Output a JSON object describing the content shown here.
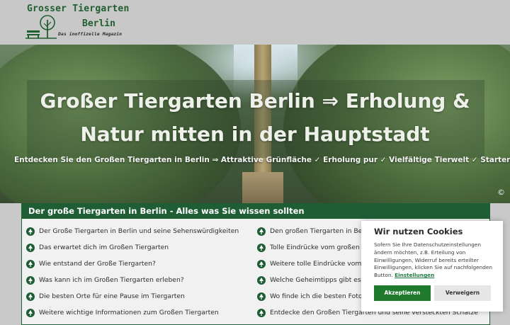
{
  "logo": {
    "line1": "Grosser Tiergarten",
    "line2": "Berlin",
    "tagline": "Das inoffizelle Magazin"
  },
  "hero": {
    "title": "Großer Tiergarten Berlin ⇒ Erholung & Natur mitten in der Hauptstadt",
    "subtitle": "Entdecken Sie den Großen Tiergarten in Berlin ⇒ Attraktive Grünfläche ✓ Erholung pur ✓ Vielfältige Tierwelt ✓ Starten Sie Ihr Abenteuer jetzt!",
    "copyright": "©"
  },
  "toc": {
    "heading": "Der große Tiergarten in Berlin - Alles was Sie wissen sollten",
    "left": [
      "Der Große Tiergarten in Berlin und seine Sehenswürdigkeiten",
      "Das erwartet dich im Großen Tiergarten",
      "Wie entstand der Große Tiergarten?",
      "Was kann ich im Großen Tiergarten erleben?",
      "Die besten Orte für eine Pause im Tiergarten",
      "Weitere wichtige Informationen zum Großen Tiergarten"
    ],
    "right": [
      "Den großen Tiergarten in Berlin a",
      "Tolle Eindrücke vom großen Tierg",
      "Weitere tolle Eindrücke vom groß",
      "Welche Geheimtipps gibt es für d",
      "Wo finde ich die besten Fotomoti",
      "Entdecke den Großen Tiergarten und seine versteckten Schätze"
    ]
  },
  "cookie": {
    "title": "Wir nutzen Cookies",
    "text": "Sofern Sie Ihre Datenschutzeinstellungen ändern möchten, z.B. Erteilung von Einwilligungen, Widerruf bereits erteilter Einwilligungen, klicken Sie auf nachfolgenden Button.",
    "link": "Einstellungen",
    "accept": "Akzeptieren",
    "reject": "Verweigern"
  },
  "colors": {
    "brand_green": "#1f5e35",
    "accept_green": "#1f7a2e",
    "header_gray": "#c8c8c8"
  },
  "icons": {
    "toc_item": "tree-icon",
    "logo": "tree-bench-icon"
  }
}
